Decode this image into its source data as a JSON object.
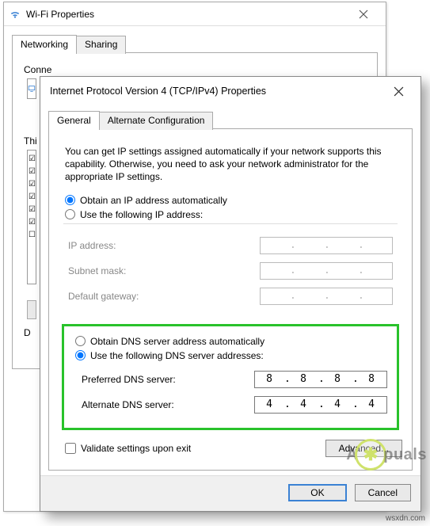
{
  "wifi": {
    "title": "Wi-Fi Properties",
    "tabs": {
      "networking": "Networking",
      "sharing": "Sharing"
    },
    "connect_label_partial": "Conne",
    "this_label_partial": "Thi",
    "d_label_partial": "D"
  },
  "ipv4": {
    "title": "Internet Protocol Version 4 (TCP/IPv4) Properties",
    "tabs": {
      "general": "General",
      "alternate": "Alternate Configuration"
    },
    "description": "You can get IP settings assigned automatically if your network supports this capability. Otherwise, you need to ask your network administrator for the appropriate IP settings.",
    "ip": {
      "auto_label": "Obtain an IP address automatically",
      "manual_label": "Use the following IP address:",
      "ip_label": "IP address:",
      "mask_label": "Subnet mask:",
      "gw_label": "Default gateway:",
      "selected": "auto"
    },
    "dns": {
      "auto_label": "Obtain DNS server address automatically",
      "manual_label": "Use the following DNS server addresses:",
      "pref_label": "Preferred DNS server:",
      "alt_label": "Alternate DNS server:",
      "selected": "manual",
      "pref": [
        "8",
        "8",
        "8",
        "8"
      ],
      "alt": [
        "4",
        "4",
        "4",
        "4"
      ]
    },
    "validate_label": "Validate settings upon exit",
    "advanced_label": "Advanced...",
    "ok_label": "OK",
    "cancel_label": "Cancel"
  },
  "watermark": {
    "left": "A",
    "right": "puals",
    "url": "wsxdn.com"
  }
}
